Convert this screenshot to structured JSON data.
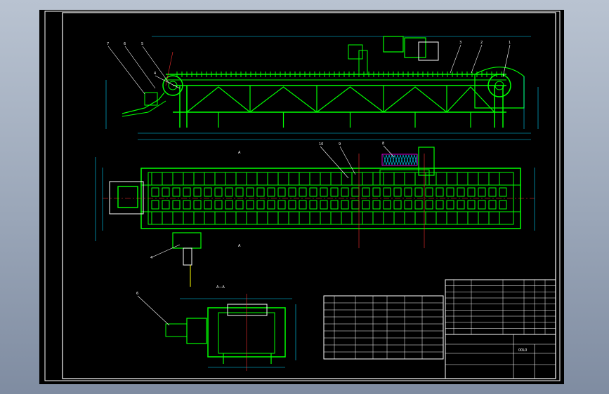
{
  "drawing": {
    "colors": {
      "background": "#000000",
      "structure": "#00ff00",
      "frame": "#ffffff",
      "dimension": "#00d8ff",
      "centerline": "#ff3030",
      "annotation": "#ffff00",
      "hatch": "#ff00ff"
    },
    "top_view_title": "",
    "section_label": "A—A",
    "view_marks": [
      "A",
      "A"
    ],
    "callouts_elevation": [
      "7",
      "6",
      "5",
      "4",
      "3",
      "2",
      "1"
    ],
    "callouts_plan": [
      "10",
      "9",
      "8"
    ],
    "callout_pump": "4",
    "callout_section": "6",
    "specs_table_title": "",
    "specs_rows": 8,
    "parts_list_rows": 9,
    "title_block": {
      "company": "",
      "drawing_no": "00L0"
    }
  }
}
